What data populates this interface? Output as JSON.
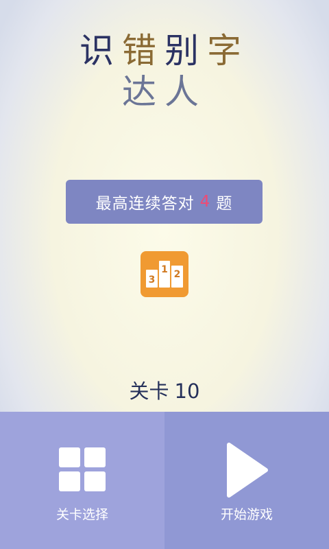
{
  "title": {
    "line1": [
      "识",
      "错",
      "别",
      "字"
    ],
    "line2": [
      "达",
      "人"
    ],
    "colors": {
      "navy": "#2b3263",
      "gold": "#8a6a34",
      "slate": "#6b7596"
    }
  },
  "best_score": {
    "prefix": "最高连续答对",
    "value": "4",
    "suffix": "题"
  },
  "podium": {
    "first": "1",
    "second": "2",
    "third": "3"
  },
  "level": {
    "label": "关卡",
    "number": "10"
  },
  "bottom_bar": {
    "select_label": "关卡选择",
    "start_label": "开始游戏"
  },
  "colors": {
    "accent_panel": "#7e86c2",
    "highlight": "#f04a73",
    "podium_bg": "#f09a32",
    "bottom_left": "#9ea3dc",
    "bottom_right": "#9098d4"
  }
}
